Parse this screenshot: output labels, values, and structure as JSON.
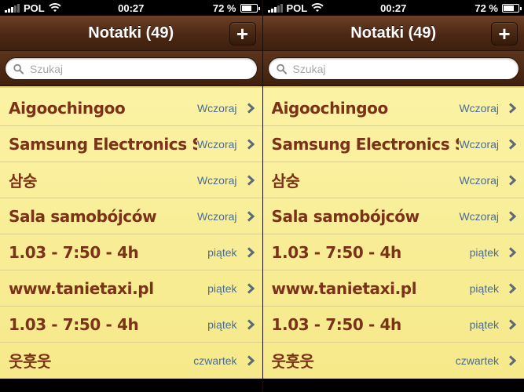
{
  "status": {
    "carrier": "POL",
    "time": "00:27",
    "battery": "72 %",
    "battery_level": 0.72
  },
  "nav": {
    "title": "Notatki (49)",
    "add_label": "+"
  },
  "search": {
    "placeholder": "Szukaj"
  },
  "notes": [
    {
      "title": "Aigoochingoo",
      "date": "Wczoraj"
    },
    {
      "title": "Samsung Electronics Sp....",
      "date": "Wczoraj"
    },
    {
      "title": "삼숭",
      "date": "Wczoraj"
    },
    {
      "title": "Sala samobójców",
      "date": "Wczoraj"
    },
    {
      "title": "1.03 - 7:50 - 4h",
      "date": "piątek"
    },
    {
      "title": "www.tanietaxi.pl",
      "date": "piątek"
    },
    {
      "title": "1.03 - 7:50 - 4h",
      "date": "piątek"
    },
    {
      "title": "웃훗웃",
      "date": "czwartek"
    }
  ]
}
